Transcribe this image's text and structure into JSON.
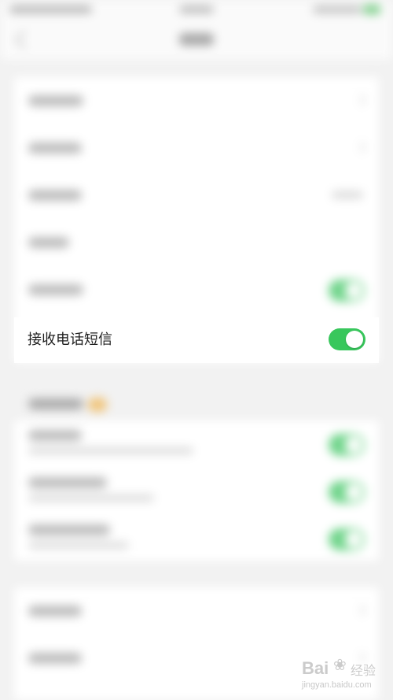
{
  "setting": {
    "label": "接收电话短信",
    "enabled": true,
    "toggle_color": "#38c75c"
  },
  "watermark": {
    "brand": "Bai",
    "suffix": "经验",
    "url": "jingyan.baidu.com"
  }
}
